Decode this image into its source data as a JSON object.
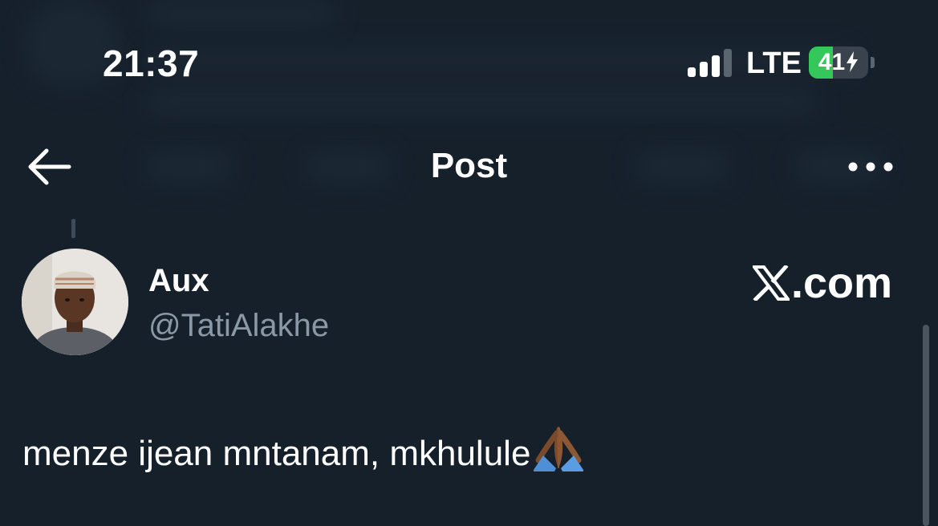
{
  "status_bar": {
    "time": "21:37",
    "network": "LTE",
    "battery_percent": "41",
    "battery_level": 0.41,
    "signal_bars_active": 3,
    "signal_bars_total": 4,
    "charging": true
  },
  "nav": {
    "title": "Post",
    "back_icon": "arrow-left-icon",
    "more_icon": "more-horizontal-icon"
  },
  "post": {
    "author_name": "Aux",
    "author_handle": "@TatiAlakhe",
    "text": "menze ijean mntanam, mkhulule",
    "emoji": "folded-hands-emoji"
  },
  "watermark": {
    "domain_suffix": ".com",
    "logo_icon": "x-logo-icon"
  },
  "colors": {
    "background": "#15202b",
    "text_primary": "#ffffff",
    "text_secondary": "#8b98a5",
    "battery_green": "#34c759"
  }
}
